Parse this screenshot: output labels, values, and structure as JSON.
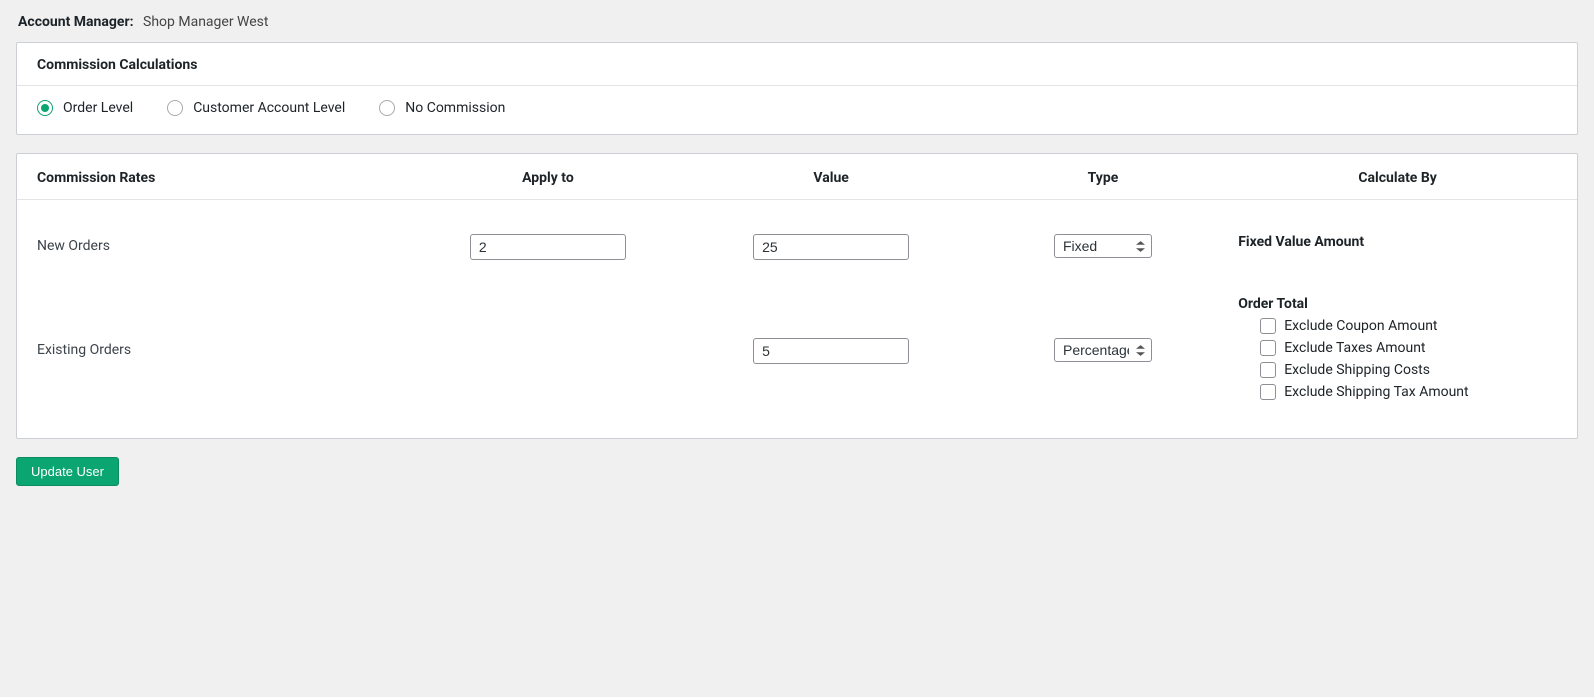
{
  "account_manager": {
    "label": "Account Manager:",
    "value": "Shop Manager West"
  },
  "calc_panel": {
    "title": "Commission Calculations",
    "options": {
      "order_level": "Order Level",
      "customer_account_level": "Customer Account Level",
      "no_commission": "No Commission"
    },
    "selected": "order_level"
  },
  "rates_panel": {
    "headers": {
      "rates": "Commission Rates",
      "apply": "Apply to",
      "value": "Value",
      "type": "Type",
      "calc": "Calculate By"
    },
    "type_options": {
      "fixed": "Fixed",
      "percentage": "Percentage"
    },
    "rows": {
      "new_orders": {
        "label": "New Orders",
        "apply_to": "2",
        "value": "25",
        "type": "fixed",
        "calc_by_label": "Fixed Value Amount"
      },
      "existing_orders": {
        "label": "Existing Orders",
        "value": "5",
        "type": "percentage",
        "order_total": {
          "title": "Order Total",
          "excludes": {
            "coupon": "Exclude Coupon Amount",
            "taxes": "Exclude Taxes Amount",
            "shipping": "Exclude Shipping Costs",
            "shipping_tax": "Exclude Shipping Tax Amount"
          }
        }
      }
    }
  },
  "buttons": {
    "update_user": "Update User"
  }
}
